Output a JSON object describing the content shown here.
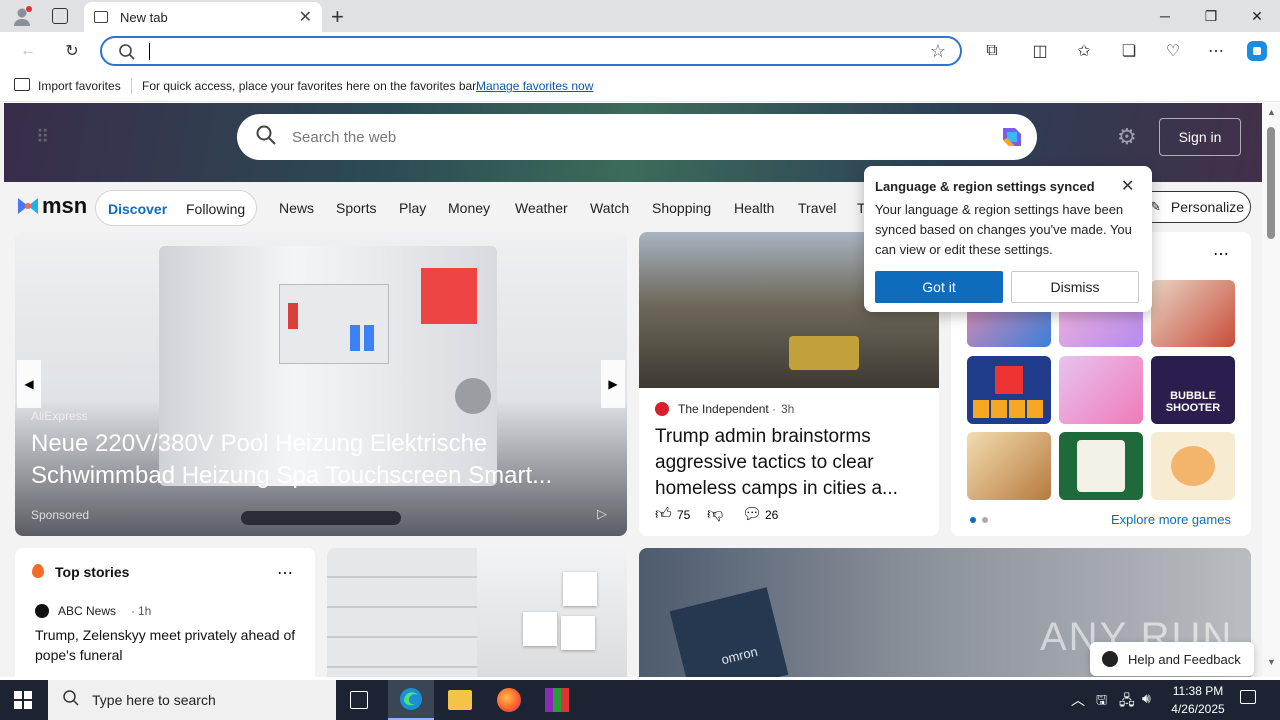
{
  "browser": {
    "tab_title": "New tab",
    "address_value": "",
    "favorites_bar": {
      "import_label": "Import favorites",
      "hint": "For quick access, place your favorites here on the favorites bar.",
      "manage_link": "Manage favorites now"
    }
  },
  "msn": {
    "search_placeholder": "Search the web",
    "sign_in": "Sign in",
    "logo": "msn",
    "tabs": [
      "Discover",
      "Following"
    ],
    "nav": [
      "News",
      "Sports",
      "Play",
      "Money",
      "Weather",
      "Watch",
      "Shopping",
      "Health",
      "Travel",
      "T"
    ],
    "personalize": "Personalize",
    "hero_card": {
      "source": "AliExpress",
      "title": "Neue 220V/380V Pool Heizung Elektrische Schwimmbad Heizung Spa Touchscreen Smart...",
      "sponsored": "Sponsored"
    },
    "news_card": {
      "source": "The Independent",
      "age": "3h",
      "title": "Trump admin brainstorms aggressive tactics to clear homeless camps in cities a...",
      "likes": "75",
      "comments": "26"
    },
    "games": {
      "explore": "Explore more games",
      "bubble_label": "BUBBLE SHOOTER"
    },
    "top_stories": {
      "heading": "Top stories",
      "source": "ABC News",
      "age": "1h",
      "headline": "Trump, Zelenskyy meet privately ahead of pope's funeral"
    },
    "popup": {
      "title": "Language & region settings synced",
      "body": "Your language & region settings have been synced based on changes you've made. You can view or edit these settings.",
      "got_it": "Got it",
      "dismiss": "Dismiss"
    },
    "feedback": "Help and Feedback",
    "watermark": "ANY RUN",
    "box_label": "omron"
  },
  "taskbar": {
    "search_placeholder": "Type here to search",
    "time": "11:38 PM",
    "date": "4/26/2025"
  },
  "colors": {
    "accent": "#2b74d6",
    "button_blue": "#0f6cbd",
    "taskbar": "#1c2433"
  }
}
